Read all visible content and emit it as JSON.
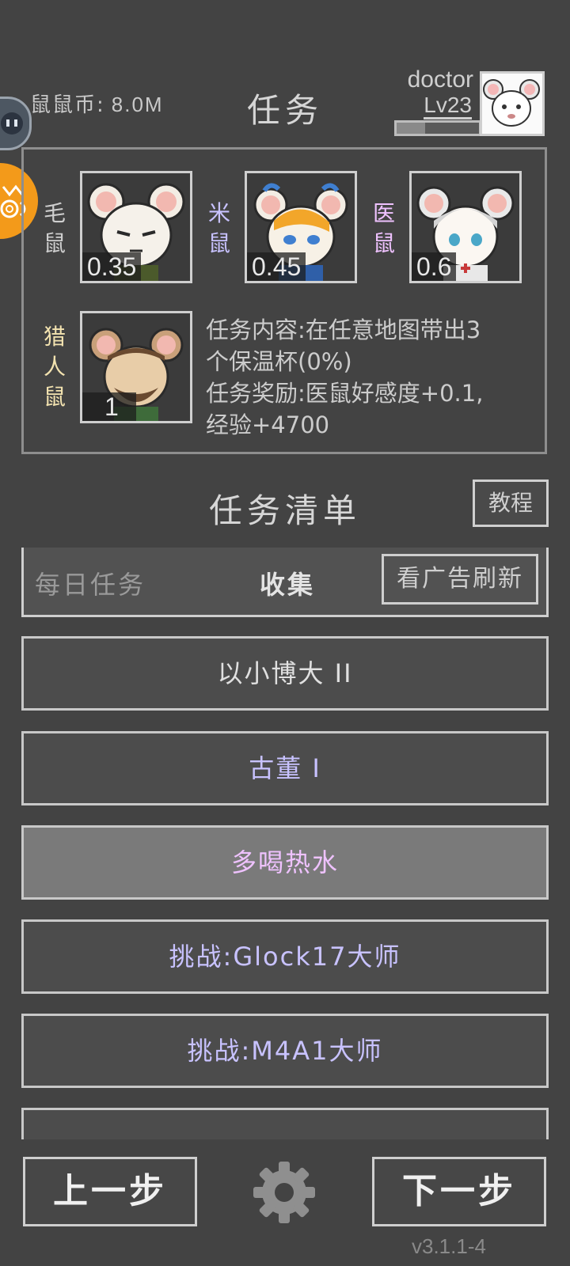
{
  "header": {
    "coins_label": "鼠鼠币:",
    "coins_value": "8.0M",
    "title": "任务",
    "username": "doctor",
    "level": "Lv23",
    "xp_fraction": 0.35
  },
  "task": {
    "rats": [
      {
        "name": "毛鼠",
        "value": "0.35",
        "color": "#cfcfcf"
      },
      {
        "name": "米鼠",
        "value": "0.45",
        "color": "#c8c2ff"
      },
      {
        "name": "医鼠",
        "value": "0.6",
        "color": "#efc2ff"
      },
      {
        "name": "猎人鼠",
        "value": "1",
        "color": "#f3e3b0"
      }
    ],
    "description_line1": "任务内容:在任意地图带出3",
    "description_line2": "个保温杯(0%)",
    "description_line3": "任务奖励:医鼠好感度+0.1,",
    "description_line4": "经验+4700"
  },
  "list": {
    "title": "任务清单",
    "tutorial": "教程",
    "tab_daily": "每日任务",
    "tab_collect": "收集",
    "ad_refresh": "看广告刷新",
    "items": [
      {
        "label": "以小博大 II",
        "color": "#e0e0e0"
      },
      {
        "label": "古董 I",
        "color": "#c8c2ff"
      },
      {
        "label": "多喝热水",
        "color": "#efc2ff"
      },
      {
        "label": "挑战:Glock17大师",
        "color": "#c8c2ff"
      },
      {
        "label": "挑战:M4A1大师",
        "color": "#c8c2ff"
      }
    ]
  },
  "nav": {
    "prev": "上一步",
    "next": "下一步",
    "settings_icon": "gear-icon"
  },
  "version": "v3.1.1-4"
}
